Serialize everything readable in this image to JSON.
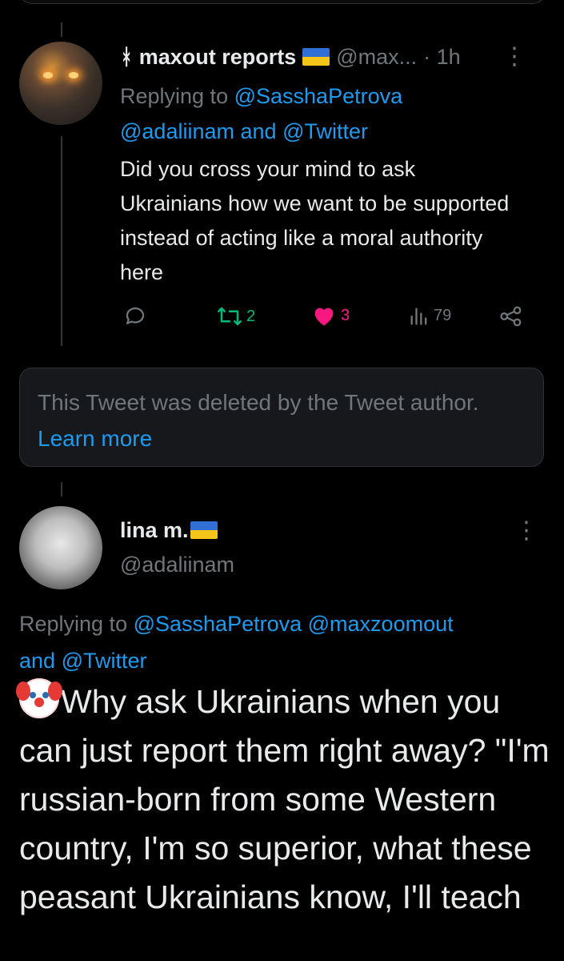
{
  "tweet1": {
    "display_name": "ᚼ maxout reports",
    "handle": "@max...",
    "time": "· 1h",
    "replying_label": "Replying to",
    "replying_handles_line1": "@SasshaPetrova",
    "replying_handles_line2_a": "@adaliinam",
    "replying_and": "and",
    "replying_handles_line2_b": "@Twitter",
    "body": "Did you cross your mind to ask Ukrainians how we want to be supported instead of acting like a moral authority here",
    "retweets": "2",
    "likes": "3",
    "views": "79"
  },
  "deleted": {
    "text": "This Tweet was deleted by the Tweet author.",
    "link": "Learn more"
  },
  "tweet2": {
    "display_name": "lina m.",
    "handle": "@adaliinam",
    "replying_label": "Replying to",
    "replying_handle_a": "@SasshaPetrova",
    "replying_handle_b": "@maxzoomout",
    "replying_and": "and",
    "replying_handle_c": "@Twitter",
    "body": "Why ask Ukrainians when you can just report them right away? \"I'm russian-born from some Western country, I'm so superior, what these peasant Ukrainians know, I'll teach"
  },
  "colors": {
    "link": "#1d9bf0",
    "retweet": "#00ba7c",
    "like": "#f91880",
    "muted": "#71767b"
  },
  "icons": [
    "more-icon",
    "reply-icon",
    "retweet-icon",
    "like-icon",
    "views-icon",
    "share-icon",
    "flag-ukraine-icon",
    "clown-emoji-icon"
  ]
}
